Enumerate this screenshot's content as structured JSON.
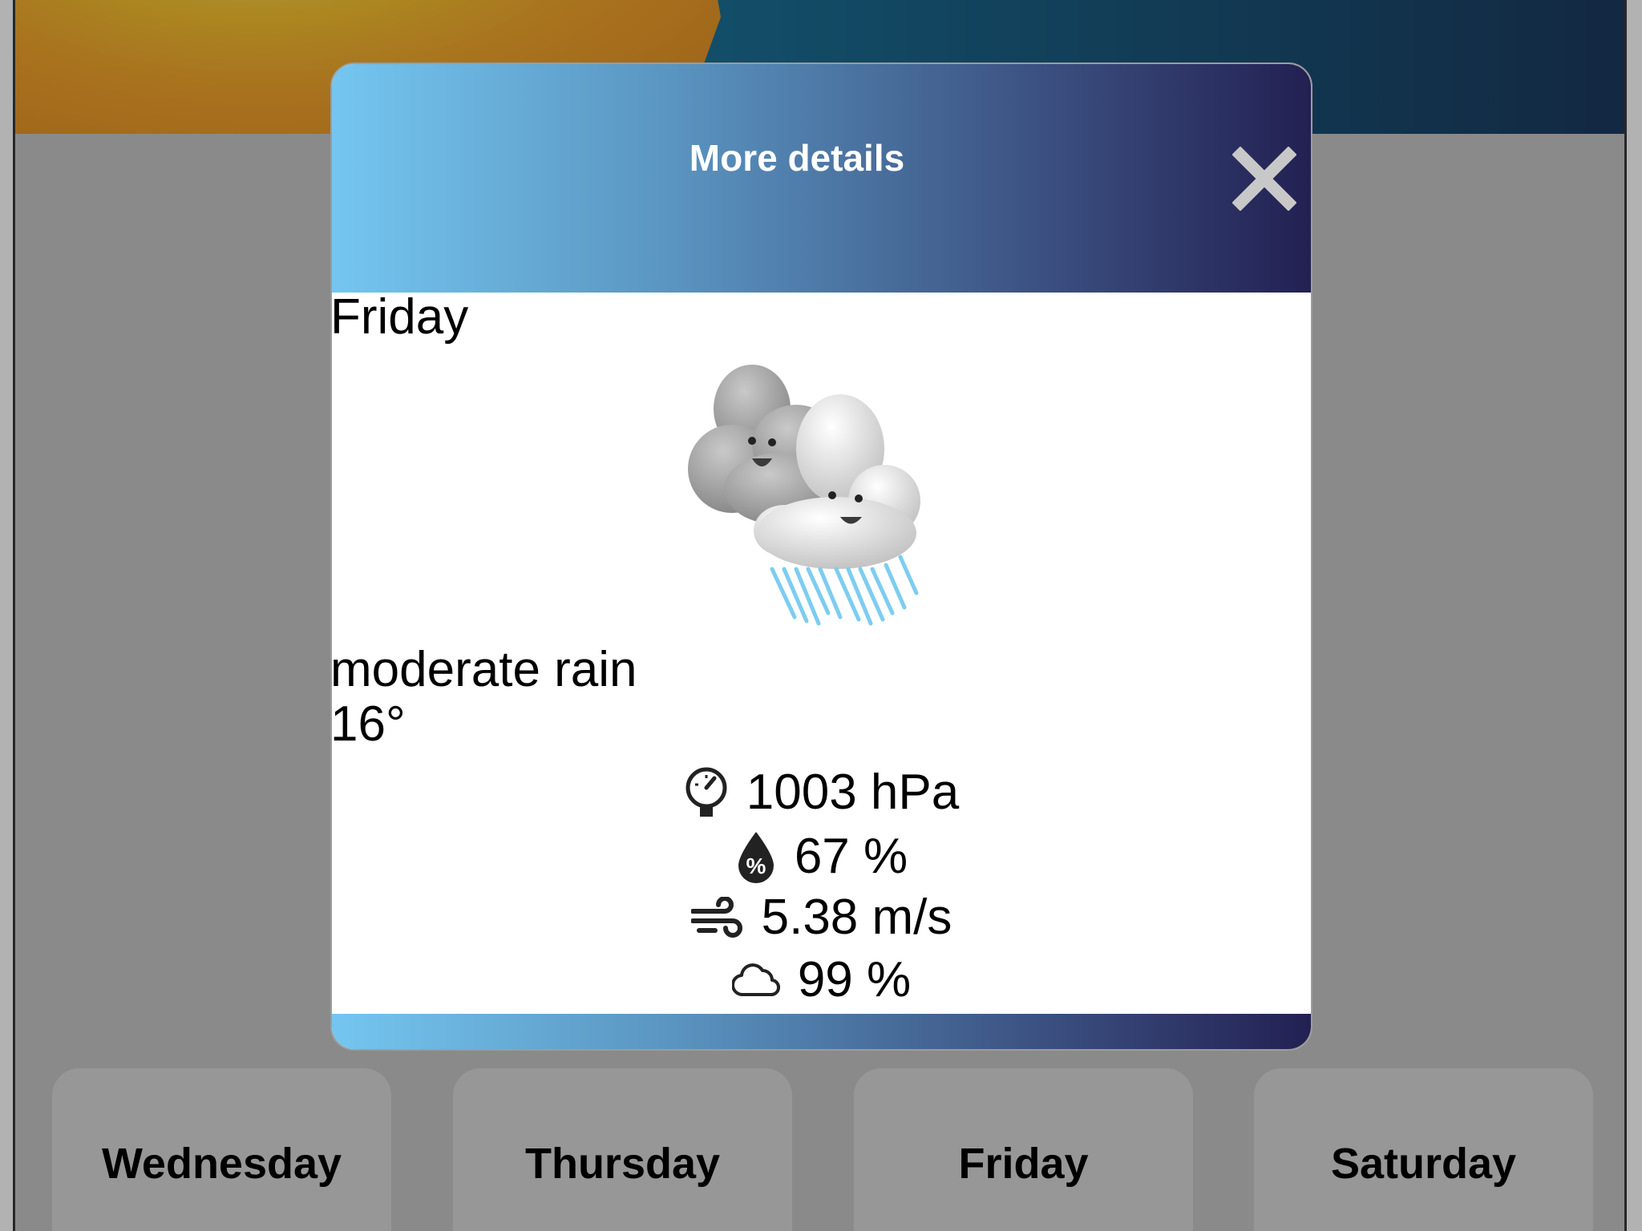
{
  "background": {
    "forecast_days": [
      "Wednesday",
      "Thursday",
      "Friday",
      "Saturday"
    ]
  },
  "modal": {
    "title": "More details",
    "close_icon": "close-icon",
    "day": "Friday",
    "weather_icon": "rain-clouds-icon",
    "description": "moderate rain",
    "temperature": "16°",
    "pressure": {
      "icon": "pressure-gauge-icon",
      "value": "1003 hPa"
    },
    "humidity": {
      "icon": "humidity-drop-icon",
      "value": "67 %"
    },
    "wind": {
      "icon": "wind-icon",
      "value": "5.38 m/s"
    },
    "cloudiness": {
      "icon": "cloud-outline-icon",
      "value": "99 %"
    }
  },
  "colors": {
    "header_gradient_start": "#74c6f0",
    "header_gradient_end": "#232052",
    "overlay": "rgba(0,0,0,0.30)"
  }
}
